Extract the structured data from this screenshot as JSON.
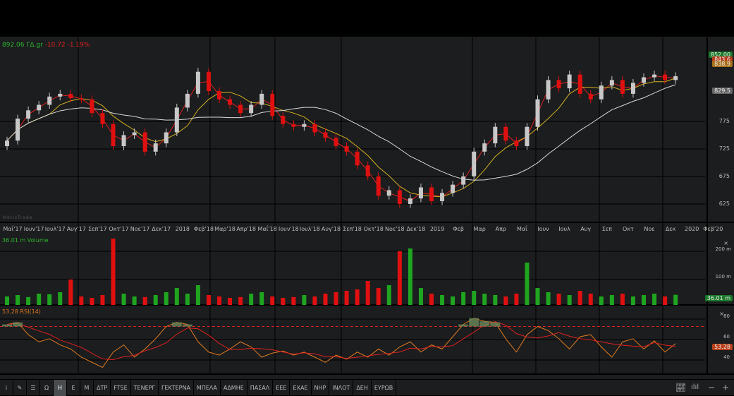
{
  "header": {
    "last_price": "892.06",
    "symbol": "ΓΔ.gr",
    "change": "-10.72",
    "change_pct": "-1.19%"
  },
  "watermark": "MetisTrade",
  "chart_data": {
    "type": "candlestick",
    "title": "ΓΔ.gr",
    "x_unit": "months since May 2017 (semi-monthly samples)",
    "x_tick_labels": [
      "Μαΐ'17",
      "Ιουν'17",
      "Ιουλ'17",
      "Αυγ'17",
      "Σεπ'17",
      "Οκτ'17",
      "Νοε'17",
      "Δεκ'17",
      "2018",
      "Φεβ'18",
      "Μαρ'18",
      "Απρ'18",
      "Μαΐ'18",
      "Ιουν'18",
      "Ιουλ'18",
      "Αυγ'18",
      "Σεπ'18",
      "Οκτ'18",
      "Νοε'18",
      "Δεκ'18",
      "2019",
      "Φεβ",
      "Μαρ",
      "Απρ",
      "Μαΐ",
      "Ιουν",
      "Ιουλ",
      "Αυγ",
      "Σεπ",
      "Οκτ",
      "Νοε",
      "Δεκ",
      "2020",
      "Φεβ'20"
    ],
    "price_axis": {
      "ticks": [
        625,
        675,
        725,
        775
      ],
      "range": [
        590,
        880
      ]
    },
    "price_tags": [
      {
        "value": "852.00",
        "color": "#1a7a2a"
      },
      {
        "value": "843.6",
        "color": "#b83a1a"
      },
      {
        "value": "838.9",
        "color": "#a8701a"
      },
      {
        "value": "829.5",
        "color": "#666666"
      }
    ],
    "close": [
      735,
      775,
      790,
      800,
      815,
      820,
      812,
      810,
      785,
      765,
      725,
      745,
      750,
      715,
      730,
      750,
      795,
      820,
      860,
      825,
      810,
      800,
      785,
      800,
      820,
      780,
      765,
      760,
      765,
      750,
      740,
      725,
      715,
      690,
      670,
      635,
      645,
      620,
      630,
      650,
      625,
      640,
      655,
      670,
      715,
      730,
      760,
      735,
      725,
      760,
      810,
      845,
      830,
      855,
      820,
      810,
      835,
      845,
      820,
      840,
      850,
      855,
      845,
      852
    ],
    "moving_averages": [
      {
        "name": "MA short",
        "color": "#e02020"
      },
      {
        "name": "MA mid",
        "color": "#d4b020"
      },
      {
        "name": "MA long",
        "color": "#d8d8d8"
      }
    ],
    "volume": {
      "label": "36.01 m Volume",
      "ticks": [
        "200 m",
        "100 m"
      ],
      "last_tag": "36.01 m",
      "unit": "m",
      "values": [
        30,
        35,
        28,
        40,
        38,
        45,
        90,
        30,
        25,
        35,
        235,
        40,
        30,
        28,
        35,
        45,
        60,
        40,
        70,
        35,
        30,
        25,
        28,
        40,
        45,
        30,
        25,
        28,
        35,
        30,
        40,
        45,
        50,
        55,
        85,
        60,
        70,
        190,
        200,
        60,
        40,
        35,
        30,
        45,
        50,
        40,
        35,
        30,
        40,
        150,
        60,
        45,
        40,
        35,
        50,
        40,
        30,
        35,
        40,
        30,
        35,
        40,
        30,
        36.01
      ]
    },
    "rsi": {
      "label": "53.28 RSI(14)",
      "ticks": [
        "80",
        "60",
        "40"
      ],
      "overbought": 70,
      "last_tag": "53.28",
      "values": [
        72,
        74,
        62,
        55,
        58,
        52,
        48,
        40,
        35,
        30,
        45,
        52,
        40,
        48,
        58,
        70,
        74,
        72,
        55,
        45,
        42,
        48,
        55,
        50,
        40,
        44,
        46,
        42,
        45,
        40,
        35,
        42,
        38,
        45,
        40,
        48,
        42,
        50,
        55,
        45,
        52,
        48,
        60,
        72,
        78,
        75,
        74,
        58,
        45,
        62,
        70,
        66,
        58,
        48,
        60,
        62,
        50,
        40,
        55,
        58,
        48,
        56,
        45,
        53.28
      ]
    }
  },
  "toolbar": {
    "items": [
      "i",
      "✎",
      "☰",
      "Ω",
      "Η",
      "Ε",
      "Μ",
      "ΔΤΡ",
      "FTSE",
      "ΤΕΝΕΡΓ",
      "ΓΕΚΤΕΡΝΑ",
      "ΜΠΕΛΑ",
      "ΑΔΜΗΕ",
      "ΠΑΣΑΛ",
      "ΕΕΕ",
      "ΕΧΑΕ",
      "ΝΗΡ",
      "ΙΝΛΟΤ",
      "ΔΕΗ",
      "ΕΥΡΩΒ"
    ],
    "active": "Η",
    "right": [
      "chart-type",
      "bars",
      "−",
      "+"
    ]
  },
  "colors": {
    "up": "#c8c8c8",
    "down": "#e01010",
    "vol_up": "#1fa51f",
    "vol_down": "#e01010",
    "rsi": "#e07a20",
    "rsi_ma": "#e02020"
  }
}
